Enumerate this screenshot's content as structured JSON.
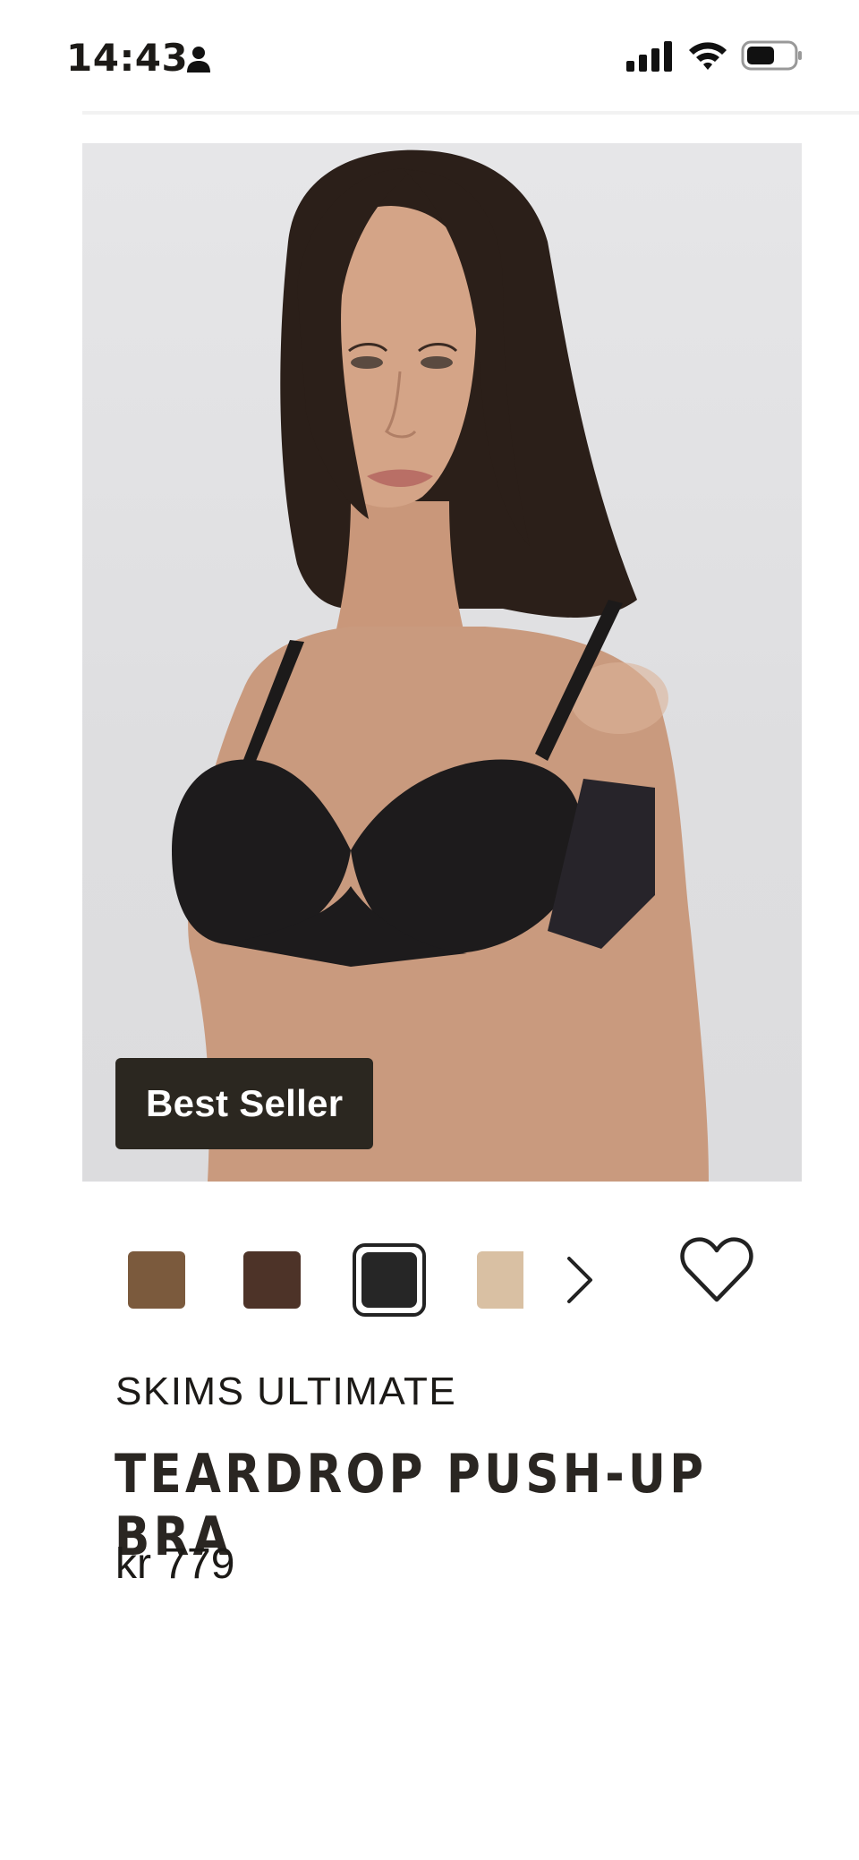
{
  "status_bar": {
    "time": "14:43"
  },
  "product": {
    "badge": "Best Seller",
    "brand": "SKIMS ULTIMATE",
    "name": "TEARDROP PUSH-UP BRA",
    "price": "kr 779"
  },
  "swatches": [
    {
      "color": "#7b5a3d",
      "selected": false
    },
    {
      "color": "#4d3328",
      "selected": false
    },
    {
      "color": "#262626",
      "selected": true
    },
    {
      "color": "#d9c0a3",
      "selected": false
    }
  ],
  "icons": {
    "person": "person-icon",
    "signal": "signal-icon",
    "wifi": "wifi-icon",
    "battery": "battery-icon",
    "more": "chevron-right-icon",
    "favorite": "heart-icon"
  }
}
